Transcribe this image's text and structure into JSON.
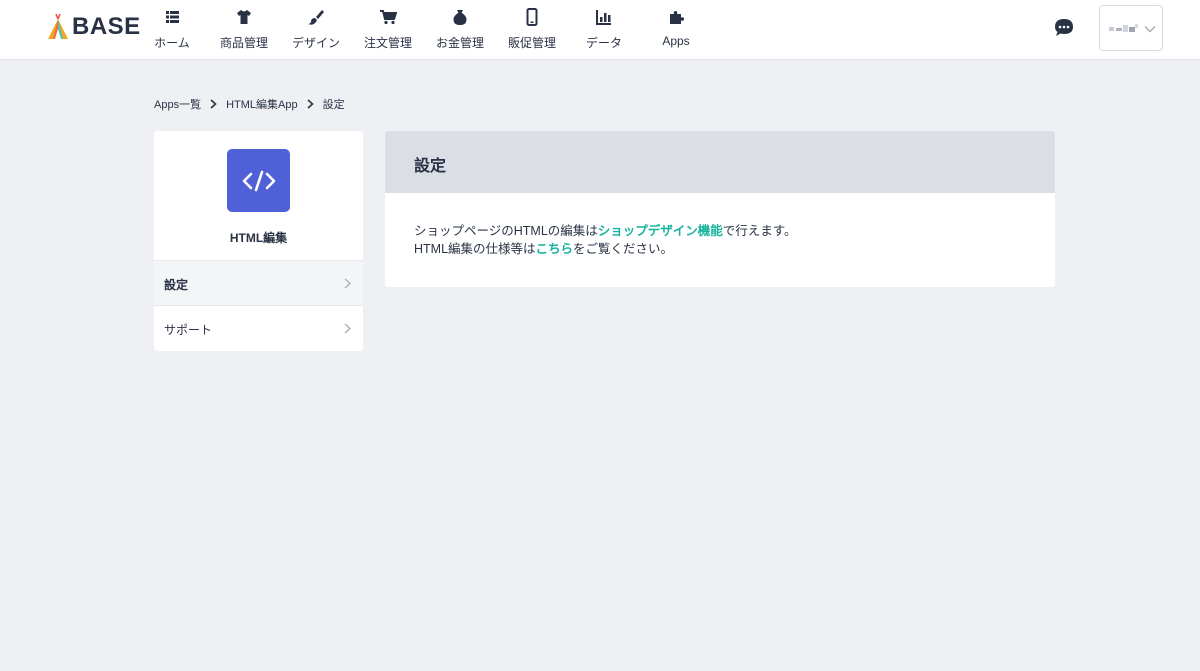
{
  "header": {
    "logo_text": "BASE",
    "nav": [
      {
        "label": "ホーム",
        "icon": "home-list-icon"
      },
      {
        "label": "商品管理",
        "icon": "tshirt-icon"
      },
      {
        "label": "デザイン",
        "icon": "paint-brush-icon"
      },
      {
        "label": "注文管理",
        "icon": "cart-icon"
      },
      {
        "label": "お金管理",
        "icon": "money-bag-icon"
      },
      {
        "label": "販促管理",
        "icon": "smartphone-icon"
      },
      {
        "label": "データ",
        "icon": "bar-chart-icon"
      },
      {
        "label": "Apps",
        "icon": "puzzle-icon"
      }
    ],
    "chat_icon": "chat-bubble-icon"
  },
  "breadcrumb": [
    "Apps一覧",
    "HTML編集App",
    "設定"
  ],
  "sidebar": {
    "app_name": "HTML編集",
    "app_icon": "code-icon",
    "items": [
      {
        "label": "設定",
        "active": true
      },
      {
        "label": "サポート",
        "active": false
      }
    ]
  },
  "panel": {
    "title": "設定",
    "line1_pre": "ショップページのHTMLの編集は",
    "line1_link": "ショップデザイン機能",
    "line1_post": "で行えます。",
    "line2_pre": "HTML編集の仕様等は",
    "line2_link": "こちら",
    "line2_post": "をご覧ください。"
  },
  "colors": {
    "brand_navy": "#293245",
    "accent_teal": "#16b49e",
    "app_icon_bg": "#5060d6",
    "page_bg": "#eff0f4"
  }
}
